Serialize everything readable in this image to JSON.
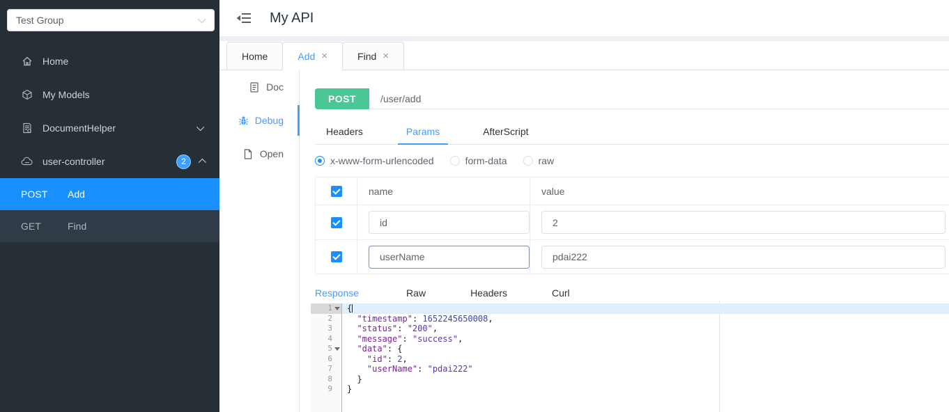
{
  "colors": {
    "primary_blue": "#409eff",
    "menu_active_blue": "#1890ff",
    "post_green": "#49c795",
    "sidebar_bg": "#262f36",
    "sidebar_submenu_bg": "#2f3b46",
    "active_line_bg": "#e1eefb",
    "json_key": "#7b1fa2",
    "json_string": "#5e35b1",
    "json_number": "#3949ab",
    "json_punct": "#1a1a1a"
  },
  "icons": {
    "close": "×"
  },
  "sidebar": {
    "group_select": {
      "value": "Test Group"
    },
    "items": [
      {
        "label": "Home",
        "icon": "home-icon"
      },
      {
        "label": "My Models",
        "icon": "models-icon"
      },
      {
        "label": "DocumentHelper",
        "icon": "document-helper-icon",
        "chevron": "down"
      },
      {
        "label": "user-controller",
        "icon": "api-cloud-icon",
        "badge": "2",
        "chevron": "up"
      }
    ],
    "sub_items": [
      {
        "method": "POST",
        "label": "Add",
        "active": true
      },
      {
        "method": "GET",
        "label": "Find",
        "active": false
      }
    ]
  },
  "header": {
    "title": "My API"
  },
  "page_tabs": [
    {
      "label": "Home",
      "closable": false,
      "active": false
    },
    {
      "label": "Add",
      "closable": true,
      "active": true
    },
    {
      "label": "Find",
      "closable": true,
      "active": false
    }
  ],
  "side_nav": [
    {
      "label": "Doc",
      "icon": "doc-icon",
      "active": false
    },
    {
      "label": "Debug",
      "icon": "bug-icon",
      "active": true
    },
    {
      "label": "Open",
      "icon": "open-file-icon",
      "active": false
    }
  ],
  "request": {
    "method": "POST",
    "url": "/user/add"
  },
  "request_tabs": [
    {
      "label": "Headers",
      "active": false
    },
    {
      "label": "Params",
      "active": true
    },
    {
      "label": "AfterScript",
      "active": false
    }
  ],
  "body_type_options": [
    {
      "label": "x-www-form-urlencoded",
      "selected": true
    },
    {
      "label": "form-data",
      "selected": false
    },
    {
      "label": "raw",
      "selected": false
    }
  ],
  "params_table": {
    "columns": {
      "name": "name",
      "value": "value"
    },
    "header_checked": true,
    "rows": [
      {
        "checked": true,
        "name": "id",
        "value": "2",
        "focused": false
      },
      {
        "checked": true,
        "name": "userName",
        "value": "pdai222",
        "focused": true
      }
    ]
  },
  "response_tabs": [
    {
      "label": "Response",
      "active": true
    },
    {
      "label": "Raw",
      "active": false
    },
    {
      "label": "Headers",
      "active": false
    },
    {
      "label": "Curl",
      "active": false
    }
  ],
  "response_editor": {
    "lines": [
      {
        "num": "1",
        "fold": true,
        "active": true,
        "cursor": true,
        "tokens": [
          {
            "type": "p",
            "text": "{"
          }
        ]
      },
      {
        "num": "2",
        "tokens": [
          {
            "type": "p",
            "text": "  "
          },
          {
            "type": "key",
            "text": "\"timestamp\""
          },
          {
            "type": "p",
            "text": ": "
          },
          {
            "type": "num",
            "text": "1652245650008"
          },
          {
            "type": "p",
            "text": ","
          }
        ]
      },
      {
        "num": "3",
        "tokens": [
          {
            "type": "p",
            "text": "  "
          },
          {
            "type": "key",
            "text": "\"status\""
          },
          {
            "type": "p",
            "text": ": "
          },
          {
            "type": "str",
            "text": "\"200\""
          },
          {
            "type": "p",
            "text": ","
          }
        ]
      },
      {
        "num": "4",
        "tokens": [
          {
            "type": "p",
            "text": "  "
          },
          {
            "type": "key",
            "text": "\"message\""
          },
          {
            "type": "p",
            "text": ": "
          },
          {
            "type": "str",
            "text": "\"success\""
          },
          {
            "type": "p",
            "text": ","
          }
        ]
      },
      {
        "num": "5",
        "fold": true,
        "tokens": [
          {
            "type": "p",
            "text": "  "
          },
          {
            "type": "key",
            "text": "\"data\""
          },
          {
            "type": "p",
            "text": ": "
          },
          {
            "type": "p",
            "text": "{"
          }
        ]
      },
      {
        "num": "6",
        "tokens": [
          {
            "type": "p",
            "text": "    "
          },
          {
            "type": "key",
            "text": "\"id\""
          },
          {
            "type": "p",
            "text": ": "
          },
          {
            "type": "num",
            "text": "2"
          },
          {
            "type": "p",
            "text": ","
          }
        ]
      },
      {
        "num": "7",
        "tokens": [
          {
            "type": "p",
            "text": "    "
          },
          {
            "type": "key",
            "text": "\"userName\""
          },
          {
            "type": "p",
            "text": ": "
          },
          {
            "type": "str",
            "text": "\"pdai222\""
          }
        ]
      },
      {
        "num": "8",
        "tokens": [
          {
            "type": "p",
            "text": "  }"
          }
        ]
      },
      {
        "num": "9",
        "tokens": [
          {
            "type": "p",
            "text": "}"
          }
        ]
      }
    ]
  }
}
